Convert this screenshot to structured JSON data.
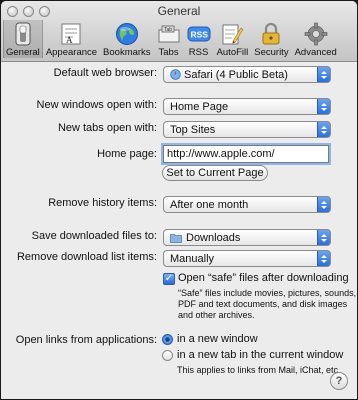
{
  "window": {
    "title": "General"
  },
  "toolbar": {
    "items": [
      {
        "label": "General",
        "icon": "general-switch-icon",
        "active": true
      },
      {
        "label": "Appearance",
        "icon": "appearance-icon"
      },
      {
        "label": "Bookmarks",
        "icon": "globe-icon"
      },
      {
        "label": "Tabs",
        "icon": "tabs-icon",
        "icon_text": "Tab"
      },
      {
        "label": "RSS",
        "icon": "rss-icon",
        "icon_text": "RSS"
      },
      {
        "label": "AutoFill",
        "icon": "autofill-pencil-icon"
      },
      {
        "label": "Security",
        "icon": "lock-icon"
      },
      {
        "label": "Advanced",
        "icon": "gear-icon"
      }
    ]
  },
  "general": {
    "default_browser": {
      "label": "Default web browser:",
      "value": "Safari (4 Public Beta)",
      "icon": "safari-compass-icon"
    },
    "new_windows": {
      "label": "New windows open with:",
      "value": "Home Page"
    },
    "new_tabs": {
      "label": "New tabs open with:",
      "value": "Top Sites"
    },
    "home_page": {
      "label": "Home page:",
      "value": "http://www.apple.com/"
    },
    "set_current_button": "Set to Current Page",
    "remove_history": {
      "label": "Remove history items:",
      "value": "After one month"
    },
    "save_downloads": {
      "label": "Save downloaded files to:",
      "value": "Downloads",
      "icon": "folder-icon"
    },
    "remove_downloads": {
      "label": "Remove download list items:",
      "value": "Manually"
    },
    "open_safe": {
      "label": "Open “safe” files after downloading",
      "checked": true,
      "note_lines": [
        "“Safe” files include movies, pictures, sounds,",
        "PDF and text documents, and disk images",
        "and other archives."
      ]
    },
    "open_links": {
      "label": "Open links from applications:",
      "options": [
        {
          "label": "in a new window",
          "selected": true
        },
        {
          "label": "in a new tab in the current window",
          "selected": false
        }
      ],
      "note": "This applies to links from Mail, iChat, etc."
    },
    "help_button": "?"
  },
  "colors": {
    "accent": "#2d6fd8",
    "focus_ring": "#8fb6ec",
    "window_bg": "#ececec"
  }
}
